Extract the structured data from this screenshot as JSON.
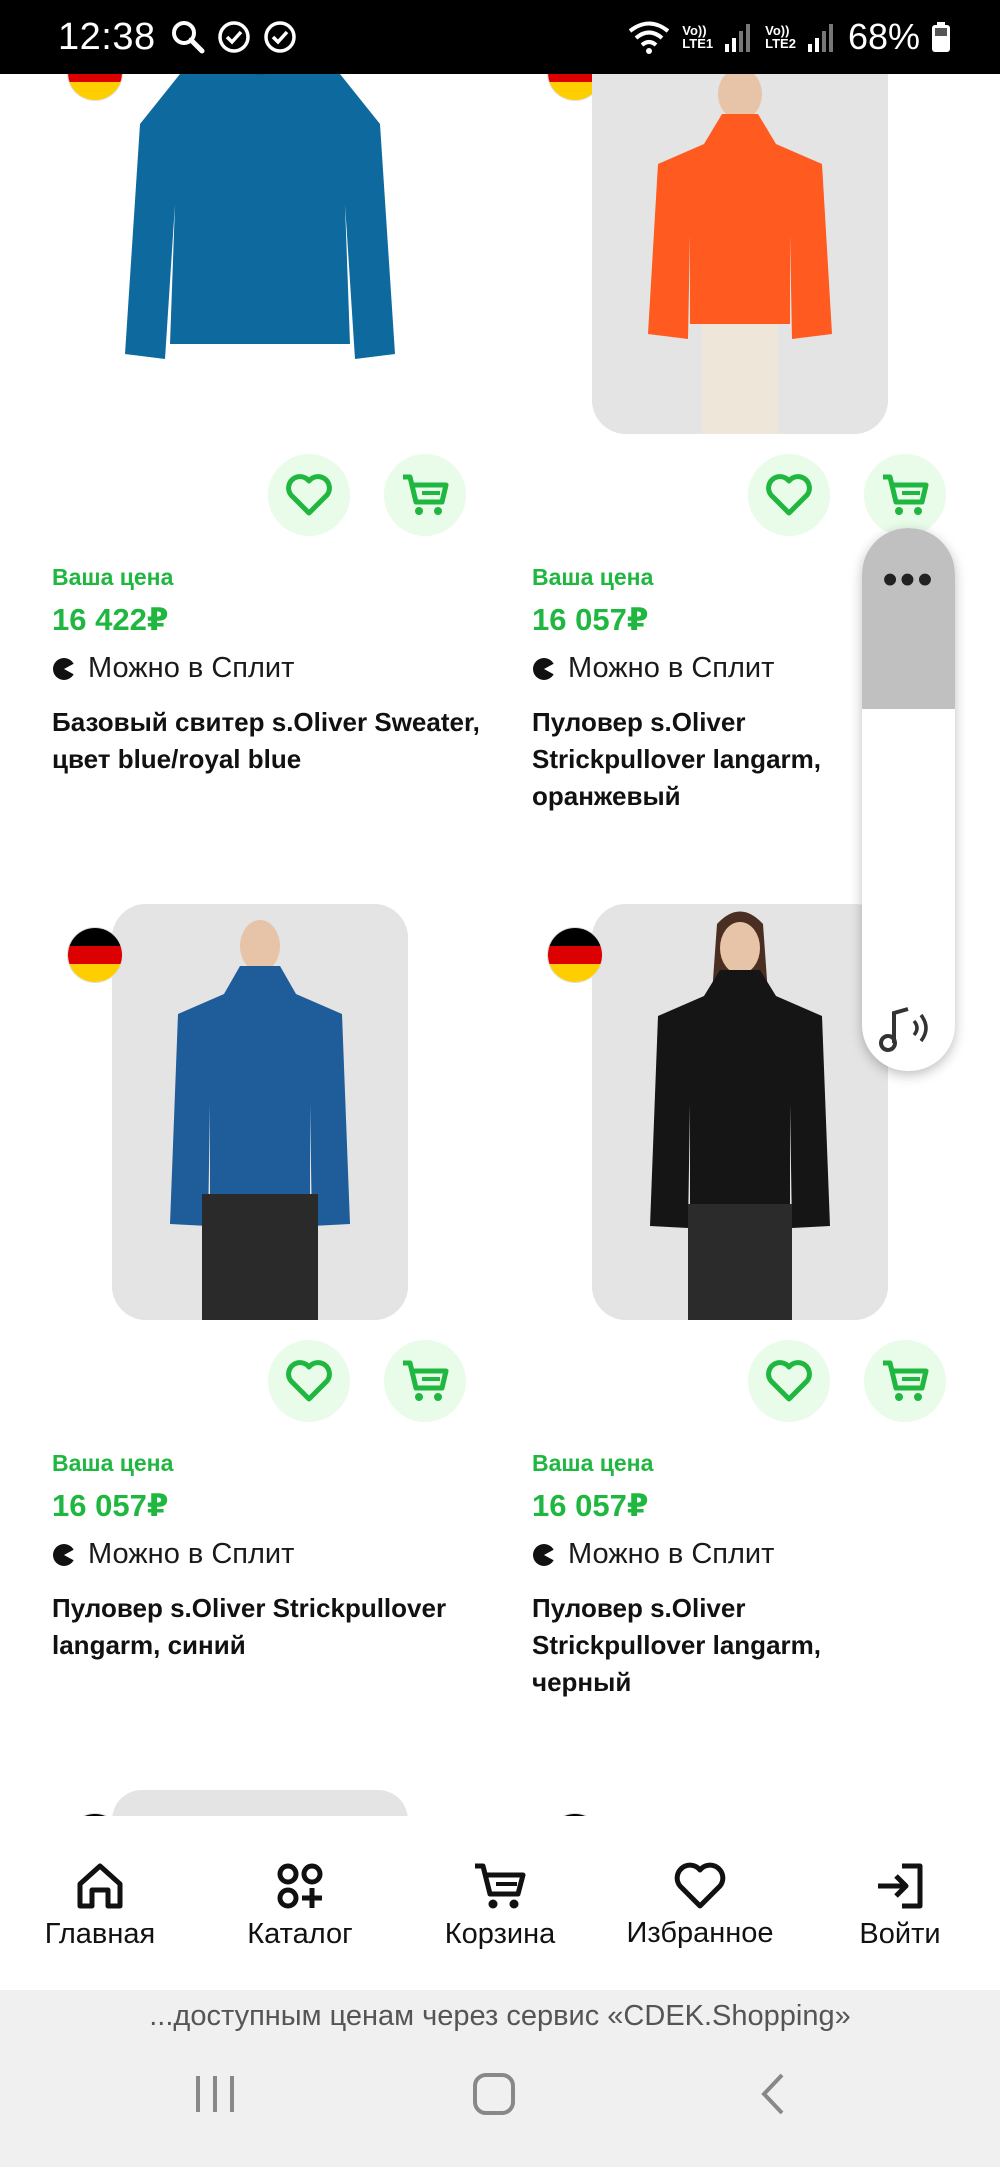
{
  "status_bar": {
    "time": "12:38",
    "battery": "68%",
    "sim1": "Vo))\nLTE1",
    "sim2": "Vo))\nLTE2"
  },
  "products": [
    {
      "price_label": "Ваша цена",
      "price": "16 422₽",
      "split_text": "Можно в Сплит",
      "title": "Базовый свитер s.Oliver Sweater, цвет blue/royal blue",
      "color": "#0e6a9e"
    },
    {
      "price_label": "Ваша цена",
      "price": "16 057₽",
      "split_text": "Можно в Сплит",
      "title": "Пуловер s.Oliver Strickpullover langarm, оранжевый",
      "color": "#ff5a1f"
    },
    {
      "price_label": "Ваша цена",
      "price": "16 057₽",
      "split_text": "Можно в Сплит",
      "title": "Пуловер s.Oliver Strickpullover langarm, синий",
      "color": "#1f5c9a"
    },
    {
      "price_label": "Ваша цена",
      "price": "16 057₽",
      "split_text": "Можно в Сплит",
      "title": "Пуловер s.Oliver Strickpullover langarm, черный",
      "color": "#151515"
    }
  ],
  "bottom_nav": [
    {
      "label": "Главная",
      "icon": "home-icon"
    },
    {
      "label": "Каталог",
      "icon": "catalog-icon"
    },
    {
      "label": "Корзина",
      "icon": "cart-icon"
    },
    {
      "label": "Избранное",
      "icon": "heart-icon"
    },
    {
      "label": "Войти",
      "icon": "login-icon"
    }
  ],
  "banner": "...доступным ценам через сервис «CDEK.Shopping»",
  "colors": {
    "accent": "#1fb740",
    "accent_bg": "#e9fbe9"
  }
}
